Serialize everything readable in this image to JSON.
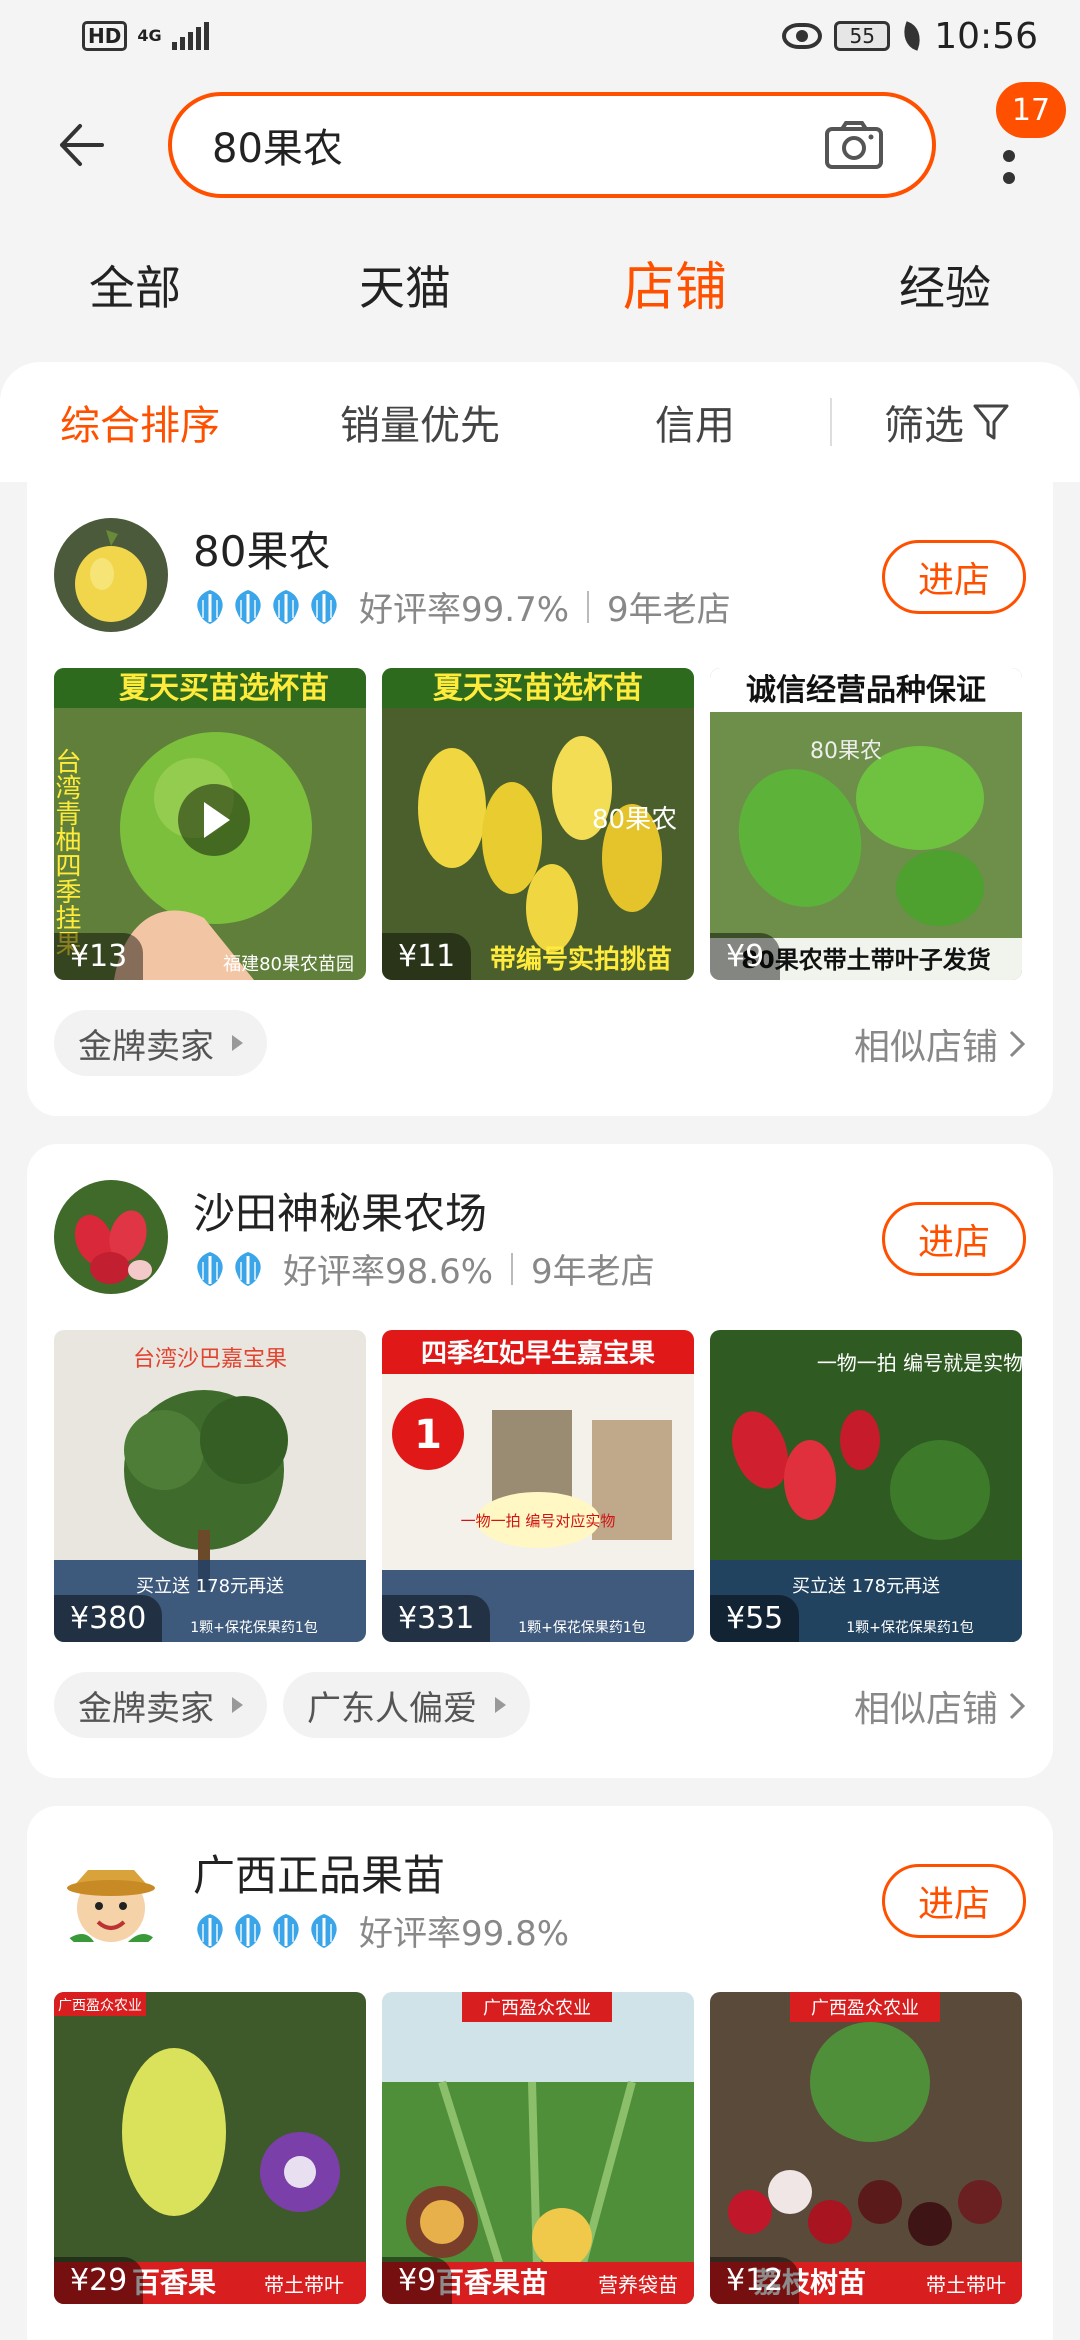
{
  "status_bar": {
    "hd": "HD",
    "network": "4G",
    "battery": "55",
    "time": "10:56"
  },
  "search": {
    "query": "80果农",
    "badge_count": "17"
  },
  "tabs": [
    {
      "label": "全部"
    },
    {
      "label": "天猫"
    },
    {
      "label": "店铺"
    },
    {
      "label": "经验"
    }
  ],
  "active_tab": "店铺",
  "sort": {
    "overall": "综合排序",
    "sales": "销量优先",
    "credit": "信用",
    "filter": "筛选"
  },
  "shops": [
    {
      "name": "80果农",
      "crowns": 4,
      "rating": "好评率99.7%",
      "age": "9年老店",
      "enter": "进店",
      "items": [
        {
          "caption": "夏天买苗选杯苗",
          "caption2": "台湾青柚四季挂果",
          "price": "¥13",
          "footer": "福建80果农苗园"
        },
        {
          "caption": "夏天买苗选杯苗",
          "caption2": "带编号实拍挑苗",
          "price": "¥11",
          "footer": "80果农"
        },
        {
          "caption": "诚信经营品种保证",
          "caption2": "80果农带土带叶子发货",
          "price": "¥9",
          "footer": "80果农"
        }
      ],
      "tags": [
        "金牌卖家"
      ],
      "similar": "相似店铺"
    },
    {
      "name": "沙田神秘果农场",
      "crowns": 2,
      "rating": "好评率98.6%",
      "age": "9年老店",
      "enter": "进店",
      "items": [
        {
          "caption": "台湾沙巴嘉宝果",
          "caption2": "买立送 178元再送",
          "price": "¥380",
          "footer": "1颗+保花保果药1包"
        },
        {
          "caption": "四季红妃早生嘉宝果",
          "caption2": "一物一拍 编号对应实物",
          "price": "¥331",
          "footer": "1颗+保花保果药1包"
        },
        {
          "caption": "一物一拍 编号就是实物",
          "caption2": "买立送 178元再送",
          "price": "¥55",
          "footer": "1颗+保花保果药1包"
        }
      ],
      "tags": [
        "金牌卖家",
        "广东人偏爱"
      ],
      "similar": "相似店铺"
    },
    {
      "name": "广西正品果苗",
      "crowns": 4,
      "rating": "好评率99.8%",
      "age": "",
      "enter": "进店",
      "items": [
        {
          "caption": "广西盈众农业",
          "caption2": "百香果",
          "price": "¥29",
          "footer": "带土带叶"
        },
        {
          "caption": "广西盈众农业",
          "caption2": "百香果苗",
          "price": "¥9",
          "footer": "营养袋苗"
        },
        {
          "caption": "广西盈众农业",
          "caption2": "荔枝树苗",
          "price": "¥12",
          "footer": "带土带叶"
        }
      ],
      "tags": [],
      "similar": ""
    }
  ],
  "colors": {
    "accent": "#ff5000",
    "crown": "#3aa5e8"
  }
}
